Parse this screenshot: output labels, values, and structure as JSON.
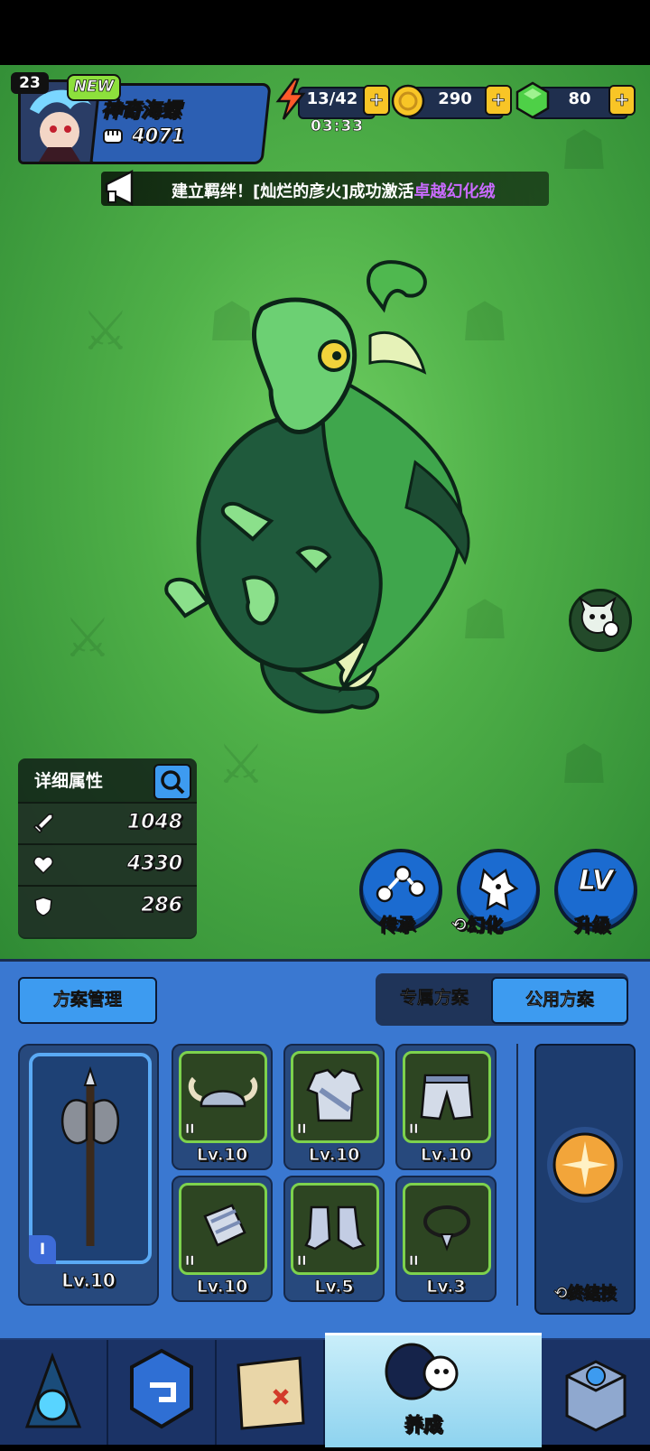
{
  "player": {
    "level": "23",
    "new_badge": "NEW",
    "name": "神奇海螺",
    "power": "4071"
  },
  "resources": {
    "energy": "13/42",
    "energy_timer": "03:33",
    "gold": "290",
    "gems": "80",
    "plus": "+"
  },
  "announcement": {
    "prefix": "建立羁绊！[灿烂的彦火]成功激活",
    "highlight": "卓越幻化绒"
  },
  "stats": {
    "title": "详细属性",
    "attack": "1048",
    "health": "4330",
    "defense": "286"
  },
  "actions": {
    "inherit": "传承",
    "transform": "幻化",
    "upgrade": "升级",
    "upgrade_icon_text": "LV"
  },
  "panel": {
    "scheme_manage": "方案管理",
    "tab_exclusive": "专属方案",
    "tab_public": "公用方案",
    "weapon": {
      "tier": "I",
      "level": "Lv.10"
    },
    "equipment": [
      {
        "name": "helmet-icon",
        "tier": "II",
        "level": "Lv.10"
      },
      {
        "name": "armor-icon",
        "tier": "II",
        "level": "Lv.10"
      },
      {
        "name": "pants-icon",
        "tier": "II",
        "level": "Lv.10"
      },
      {
        "name": "bracer-icon",
        "tier": "II",
        "level": "Lv.10"
      },
      {
        "name": "boots-icon",
        "tier": "II",
        "level": "Lv.5"
      },
      {
        "name": "necklace-icon",
        "tier": "II",
        "level": "Lv.3"
      }
    ],
    "skill_label": "终结技"
  },
  "nav": {
    "active_label": "养成"
  },
  "colors": {
    "accent_blue": "#3a78d1",
    "gold": "#f8c526",
    "purple_highlight": "#c96bff",
    "green_border": "#7dd24d"
  }
}
